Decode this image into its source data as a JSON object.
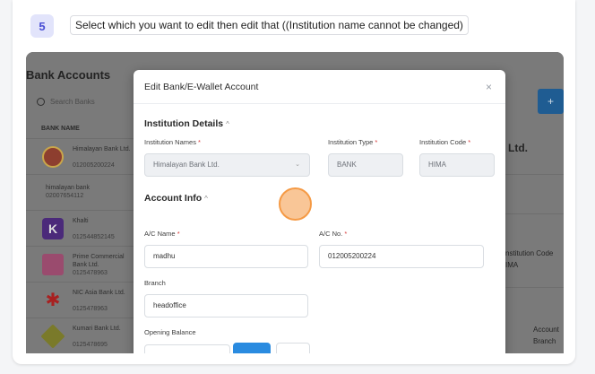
{
  "step": {
    "number": "5",
    "instruction": "Select which you want to edit then edit that ((Institution name cannot be changed)"
  },
  "background": {
    "page_title": "Bank Accounts",
    "search_placeholder": "Search Banks",
    "column_header": "BANK NAME",
    "add_button_label": "+",
    "banks": [
      {
        "name": "Himalayan Bank Ltd.",
        "number": "012005200224",
        "logo_color": "#8d3e2f"
      },
      {
        "name": "himalayan bank",
        "number": "02007654112",
        "logo_color": ""
      },
      {
        "name": "Khalti",
        "number": "012544852145",
        "logo_color": "#4b2a7a"
      },
      {
        "name": "Prime Commercial Bank Ltd.",
        "number": "0125478963",
        "logo_color": "#9a4b6e"
      },
      {
        "name": "NIC Asia Bank Ltd.",
        "number": "0125478963",
        "logo_color": "#a82020"
      },
      {
        "name": "Kumari Bank Ltd.",
        "number": "0125478695",
        "logo_color": "#7a7a2a"
      }
    ],
    "right_fragments": {
      "ltd_text": "Ltd.",
      "institution_code_text": "nstitution Code",
      "hima_text": "IMA",
      "account_text": "Account",
      "branch_text": "Branch"
    }
  },
  "modal": {
    "title": "Edit Bank/E-Wallet Account",
    "close_label": "×",
    "institution_details": {
      "heading": "Institution Details",
      "chevron": "^",
      "institution_names_label": "Institution Names",
      "institution_names_value": "Himalayan Bank Ltd.",
      "institution_type_label": "Institution Type",
      "institution_type_value": "BANK",
      "institution_code_label": "Institution Code",
      "institution_code_value": "HIMA",
      "required_mark": "*"
    },
    "account_info": {
      "heading": "Account Info",
      "chevron": "^",
      "ac_name_label": "A/C Name",
      "ac_name_value": "madhu",
      "ac_no_label": "A/C No.",
      "ac_no_value": "012005200224",
      "branch_label": "Branch",
      "branch_value": "headoffice",
      "opening_balance_label": "Opening Balance"
    }
  },
  "colors": {
    "accent": "#4a4fd4",
    "highlight": "#f59a45",
    "primary_button": "#2a8be0"
  }
}
